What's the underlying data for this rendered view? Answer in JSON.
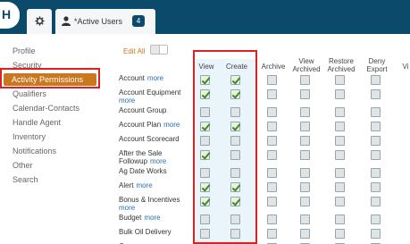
{
  "header": {
    "logo_letter": "H",
    "tab_label": "*Active Users",
    "tab_badge": "4",
    "accent": "#0b4a6b"
  },
  "sidebar": {
    "items": [
      "Profile",
      "Security",
      "Activity Permissions",
      "Qualifiers",
      "Calendar-Contacts",
      "Handle Agent",
      "Inventory",
      "Notifications",
      "Other",
      "Search"
    ],
    "active_index": 2,
    "active_color": "#c9781f"
  },
  "toolbar": {
    "edit_all_label": "Edit All"
  },
  "table": {
    "columns": [
      "View",
      "Create",
      "Archive",
      "View\nArchived",
      "Restore\nArchived",
      "Deny\nExport",
      "Vi"
    ],
    "more_label": "more",
    "rows": [
      {
        "label": "Account",
        "more": true,
        "checks": [
          1,
          1,
          0,
          0,
          0,
          0
        ]
      },
      {
        "label": "Account Equipment",
        "more": true,
        "checks": [
          1,
          1,
          0,
          0,
          0,
          0
        ]
      },
      {
        "label": "Account Group",
        "more": false,
        "checks": [
          0,
          0,
          0,
          0,
          0,
          0
        ]
      },
      {
        "label": "Account Plan",
        "more": true,
        "checks": [
          1,
          1,
          0,
          0,
          0,
          0
        ]
      },
      {
        "label": "Account Scorecard",
        "more": false,
        "checks": [
          0,
          0,
          0,
          0,
          0,
          0
        ]
      },
      {
        "label": "After the Sale\nFollowup",
        "more": true,
        "checks": [
          1,
          0,
          0,
          0,
          0,
          0
        ]
      },
      {
        "label": "Ag Date Works",
        "more": false,
        "checks": [
          0,
          0,
          0,
          0,
          0,
          0
        ]
      },
      {
        "label": "Alert",
        "more": true,
        "checks": [
          1,
          1,
          0,
          0,
          0,
          0
        ]
      },
      {
        "label": "Bonus & Incentives",
        "more": true,
        "checks": [
          1,
          1,
          0,
          0,
          0,
          0
        ]
      },
      {
        "label": "Budget",
        "more": true,
        "checks": [
          0,
          0,
          0,
          0,
          0,
          0
        ]
      },
      {
        "label": "Bulk Oil Delivery",
        "more": false,
        "checks": [
          0,
          0,
          0,
          0,
          0,
          0
        ]
      },
      {
        "label": "Case",
        "more": false,
        "checks": [
          1,
          1,
          0,
          0,
          0,
          0
        ]
      }
    ]
  }
}
